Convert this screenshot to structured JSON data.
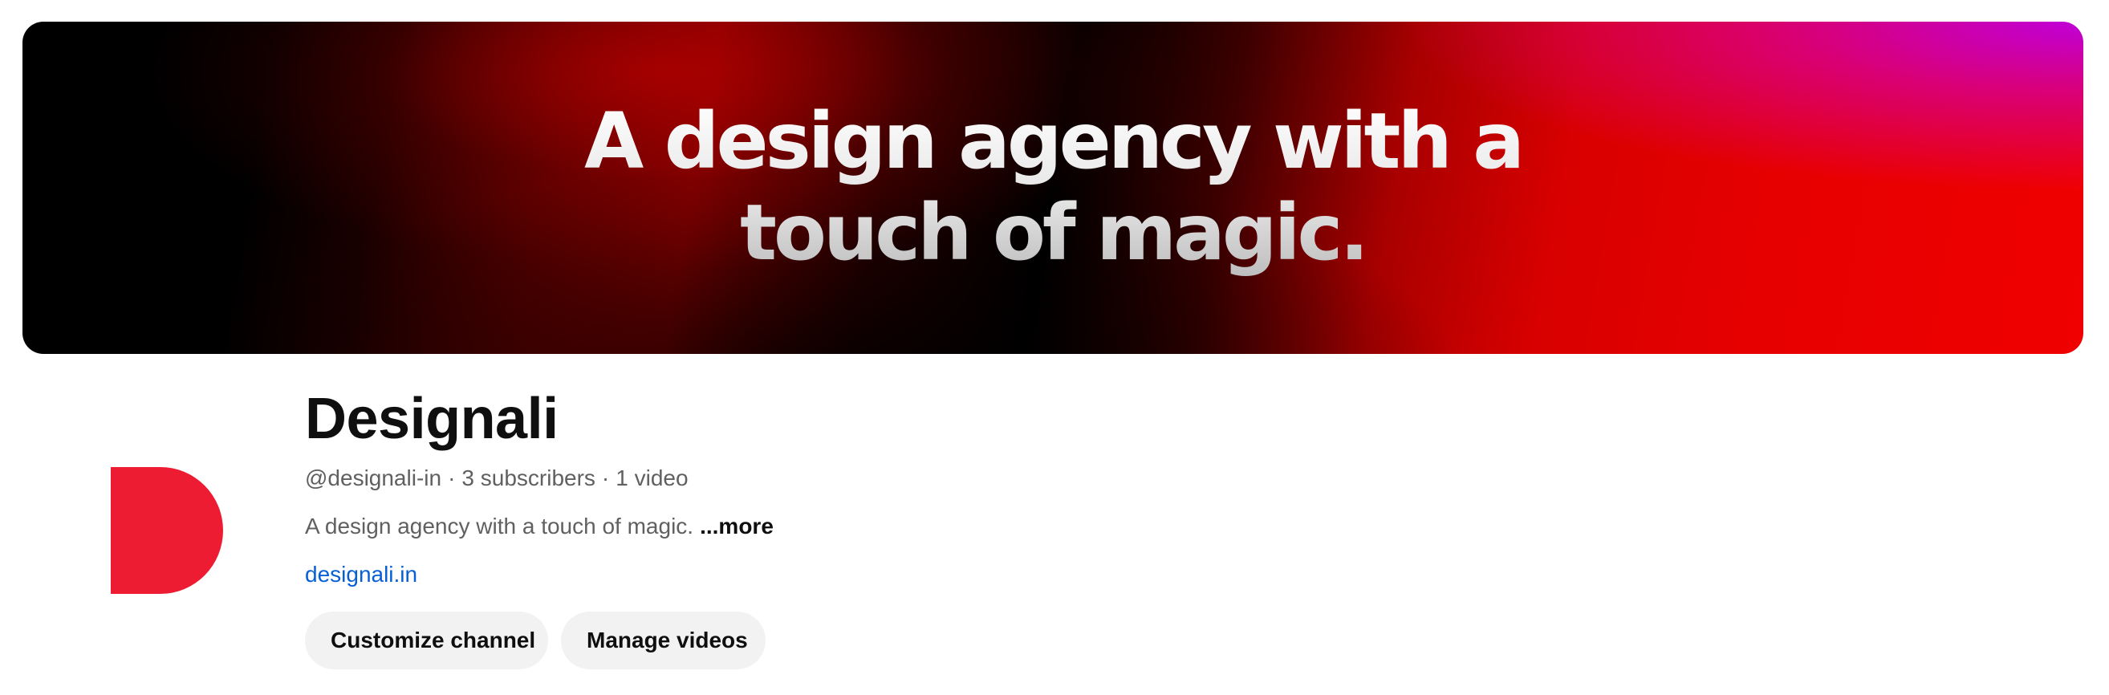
{
  "banner": {
    "headline_line1": "A design agency with a",
    "headline_line2": "touch of magic."
  },
  "channel": {
    "name": "Designali",
    "handle": "@designali-in",
    "separator": "·",
    "subscribers": "3 subscribers",
    "videos": "1 video",
    "description": "A design agency with a touch of magic.",
    "more_label": "...more",
    "link": "designali.in",
    "avatar_icon": "designali-d-logo-icon"
  },
  "actions": {
    "customize_label": "Customize channel",
    "manage_label": "Manage videos"
  },
  "colors": {
    "logo_red": "#ed1c33",
    "link_blue": "#065fd4",
    "button_bg": "#f2f2f2",
    "secondary_text": "#606060"
  }
}
